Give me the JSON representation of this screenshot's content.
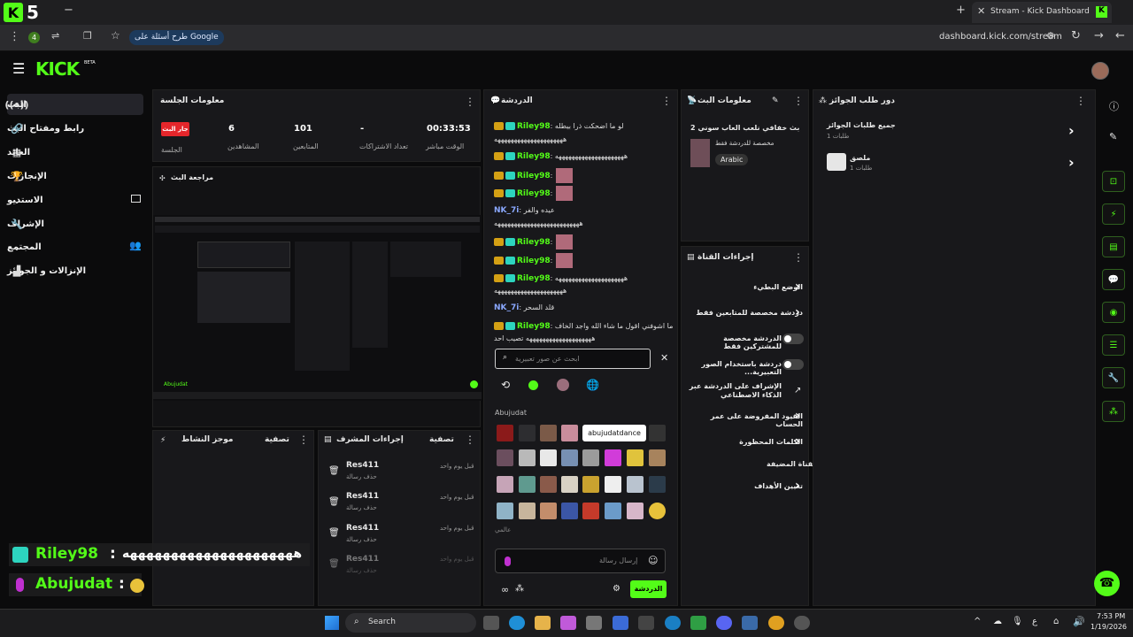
{
  "browser": {
    "tab_title": "Stream - Kick Dashboard",
    "url": "dashboard.kick.com/stream",
    "google_chip": "طرح أسئلة على Google",
    "ext_count": "4"
  },
  "header": {
    "logo": "KICK",
    "logo_sup": "BETA"
  },
  "sidebar": {
    "items": [
      {
        "label": "البث"
      },
      {
        "label": "رابط ومفتاح البث"
      },
      {
        "label": "العائد"
      },
      {
        "label": "الإنجازات"
      },
      {
        "label": "الاستديو"
      },
      {
        "label": "الإشراف"
      },
      {
        "label": "المجتمع"
      },
      {
        "label": "الإنزالات و الجوائز"
      }
    ]
  },
  "session": {
    "title": "معلومات الجلسة",
    "live_badge": "جار البث",
    "stats": [
      {
        "label": "الجلسة",
        "value": ""
      },
      {
        "label": "المشاهدين",
        "value": "6"
      },
      {
        "label": "المتابعين",
        "value": "101"
      },
      {
        "label": "تعداد الاشتراكات",
        "value": "-"
      },
      {
        "label": "الوقت مباشر",
        "value": "00:33:53"
      }
    ],
    "preview_title": "مراجعة البث",
    "preview_caption": "Abujudat"
  },
  "activity": {
    "title": "موجز النشاط",
    "filter": "تصفية"
  },
  "modactions": {
    "title": "إجراءات المشرف",
    "filter": "تصفية",
    "rows": [
      {
        "user": "Res411",
        "action": "حذف رسالة",
        "time": "قبل يوم واحد"
      },
      {
        "user": "Res411",
        "action": "حذف رسالة",
        "time": "قبل يوم واحد"
      },
      {
        "user": "Res411",
        "action": "حذف رسالة",
        "time": "قبل يوم واحد"
      },
      {
        "user": "Res411",
        "action": "حذف رسالة",
        "time": "قبل يوم واحد"
      }
    ]
  },
  "chat": {
    "title": "الدردشة",
    "messages": [
      {
        "user": "Riley98",
        "text": "لو ما اضحكت ذرا بيطله"
      },
      {
        "user": "",
        "text": "هههههههههههههههههههههه"
      },
      {
        "user": "Riley98",
        "text": "هههههههههههههههههههههه"
      },
      {
        "user": "Riley98",
        "text": ""
      },
      {
        "user": "Riley98",
        "text": ""
      },
      {
        "user": "NK_7i",
        "text": "عيده والفر"
      },
      {
        "user": "",
        "text": "ههههههههههههههههههههههههههه"
      },
      {
        "user": "Riley98",
        "text": ""
      },
      {
        "user": "Riley98",
        "text": ""
      },
      {
        "user": "Riley98",
        "text": "هههههههههههههههههههههه"
      },
      {
        "user": "",
        "text": "هههههههههههههههههههههه"
      },
      {
        "user": "NK_7i",
        "text": "قلد السحر"
      },
      {
        "user": "Riley98",
        "text": "ما اشوفني اقول ما شاء الله واجد الخاف"
      },
      {
        "user": "",
        "text": "ههههههههههههههههههههه تصيب احد"
      }
    ],
    "emote_search_placeholder": "ابحث عن صور تعبيرية",
    "emote_section": "Abujudat",
    "emote_section2": "عالمي",
    "tooltip": "abujudatdance",
    "input_placeholder": "إرسال رسالة",
    "send_label": "الدردشة"
  },
  "streaminfo": {
    "title": "معلومات البث",
    "stream_title": "بث خفافي نلعب العاب سوني 2",
    "category": "مخصصة للدردشة فقط",
    "language": "Arabic"
  },
  "channelactions": {
    "title": "إجراءات القناة",
    "items": [
      {
        "label": "الوضع البطيء",
        "control": "chevron"
      },
      {
        "label": "دردشة مخصصة للمتابعين فقط",
        "control": "chevron"
      },
      {
        "label": "الدردشة مخصصة للمشتركين فقط",
        "control": "toggle"
      },
      {
        "label": "دردشة باستخدام الصور التعبيرية...",
        "control": "toggle"
      },
      {
        "label": "الإشراف على الدردشة عبر الذكاء الاصطناعي",
        "control": "link"
      },
      {
        "label": "القيود المفروضة على عمر الحساب",
        "control": "chevron"
      },
      {
        "label": "الكلمات المحظورة",
        "control": "chevron"
      }
    ],
    "subsection": "القناة المضيفة",
    "goals": "تعيين الأهداف"
  },
  "rewards": {
    "title": "دور طلب الجوائز",
    "items": [
      {
        "label": "جميع طلبات الجوائز",
        "sub": "طلبات 1"
      },
      {
        "label": "ملصق",
        "sub": "طلبات 1"
      }
    ]
  },
  "overlay": [
    {
      "user": "Riley98",
      "text": "هههههههههههههههههههههه"
    },
    {
      "user": "Abujudat",
      "text": ""
    }
  ],
  "taskbar": {
    "search": "Search",
    "time": "7:53 PM",
    "date": "1/19/2026"
  },
  "colors": {
    "accent": "#53fc18",
    "live": "#e5262b",
    "panel": "#18181b"
  }
}
